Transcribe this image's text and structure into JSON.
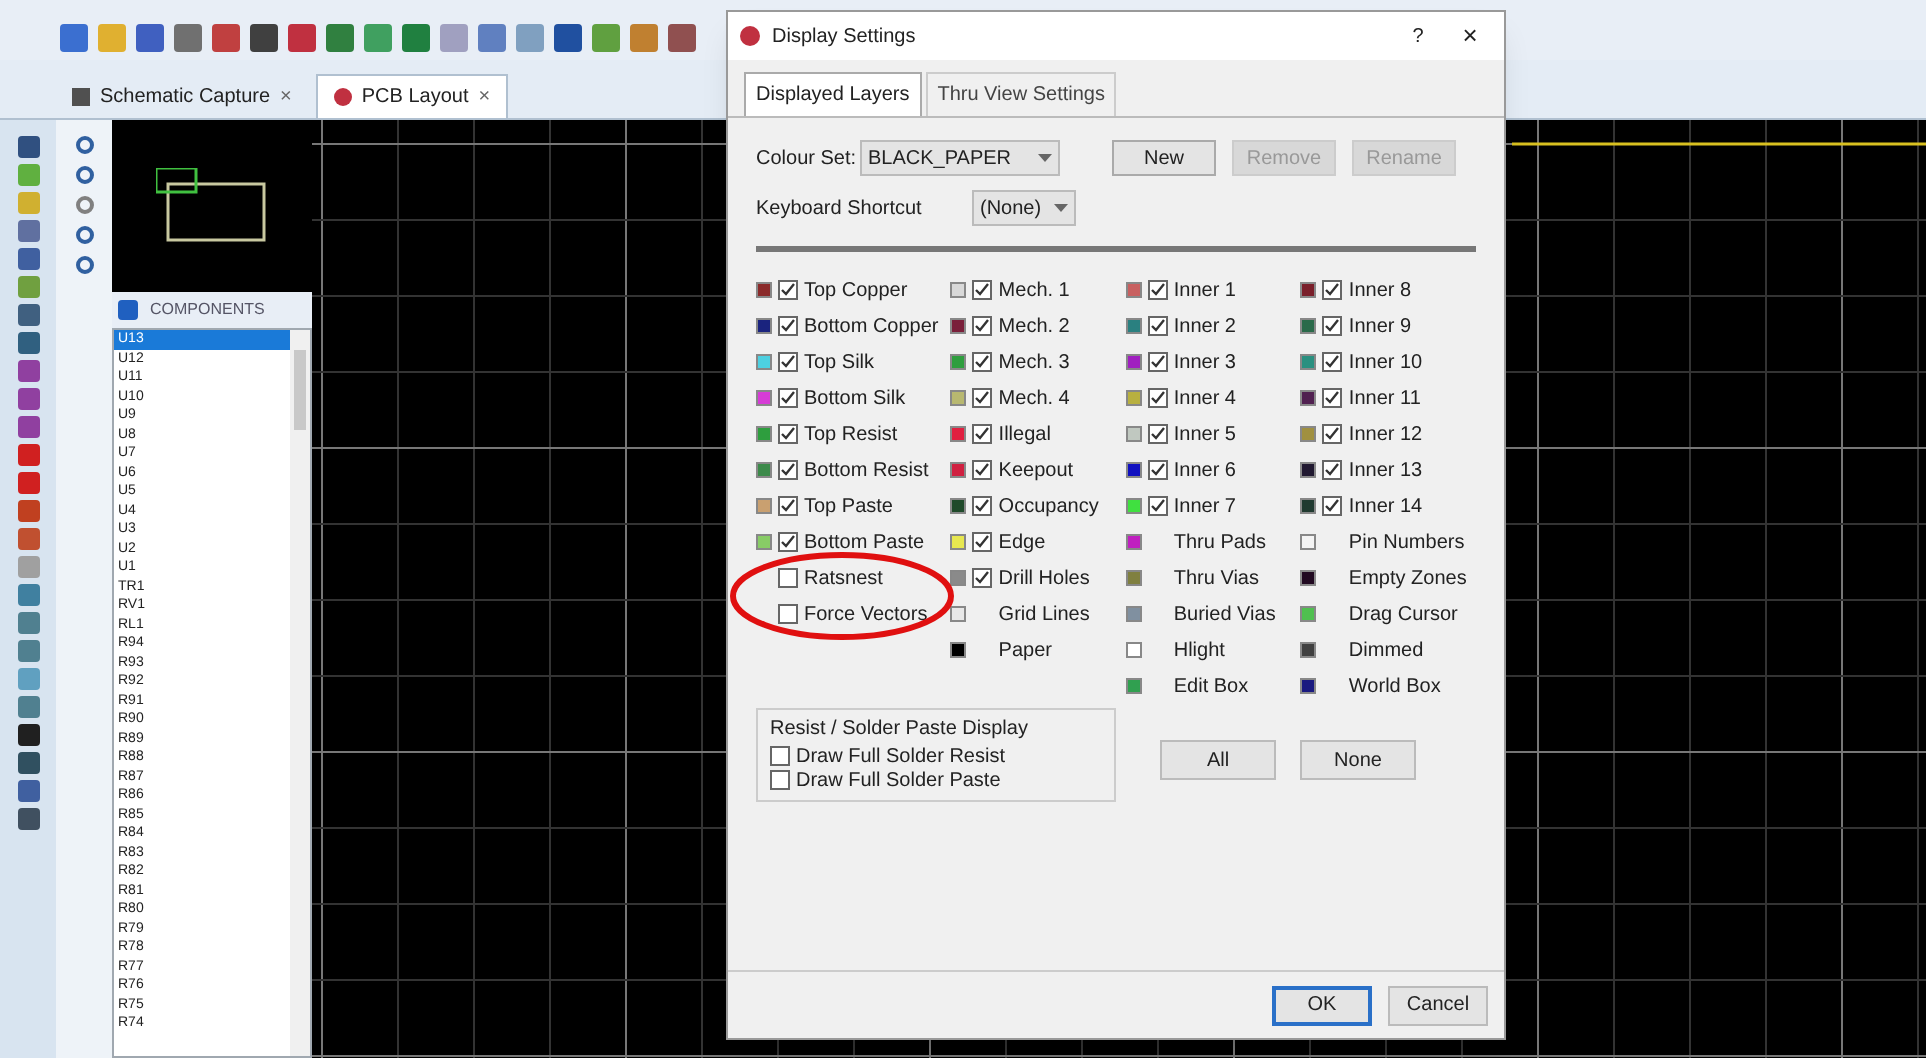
{
  "app_tabs": [
    {
      "label": "Schematic Capture",
      "close": "×",
      "selected": false
    },
    {
      "label": "PCB Layout",
      "close": "×",
      "selected": true
    }
  ],
  "components": {
    "header": "COMPONENTS",
    "items": [
      {
        "label": "U13",
        "selected": true
      },
      {
        "label": "U12",
        "selected": false
      },
      {
        "label": "U11",
        "selected": false
      },
      {
        "label": "U10",
        "selected": false
      },
      {
        "label": "U9",
        "selected": false
      },
      {
        "label": "U8",
        "selected": false
      },
      {
        "label": "U7",
        "selected": false
      },
      {
        "label": "U6",
        "selected": false
      },
      {
        "label": "U5",
        "selected": false
      },
      {
        "label": "U4",
        "selected": false
      },
      {
        "label": "U3",
        "selected": false
      },
      {
        "label": "U2",
        "selected": false
      },
      {
        "label": "U1",
        "selected": false
      },
      {
        "label": "TR1",
        "selected": false
      },
      {
        "label": "RV1",
        "selected": false
      },
      {
        "label": "RL1",
        "selected": false
      },
      {
        "label": "R94",
        "selected": false
      },
      {
        "label": "R93",
        "selected": false
      },
      {
        "label": "R92",
        "selected": false
      },
      {
        "label": "R91",
        "selected": false
      },
      {
        "label": "R90",
        "selected": false
      },
      {
        "label": "R89",
        "selected": false
      },
      {
        "label": "R88",
        "selected": false
      },
      {
        "label": "R87",
        "selected": false
      },
      {
        "label": "R86",
        "selected": false
      },
      {
        "label": "R85",
        "selected": false
      },
      {
        "label": "R84",
        "selected": false
      },
      {
        "label": "R83",
        "selected": false
      },
      {
        "label": "R82",
        "selected": false
      },
      {
        "label": "R81",
        "selected": false
      },
      {
        "label": "R80",
        "selected": false
      },
      {
        "label": "R79",
        "selected": false
      },
      {
        "label": "R78",
        "selected": false
      },
      {
        "label": "R77",
        "selected": false
      },
      {
        "label": "R76",
        "selected": false
      },
      {
        "label": "R75",
        "selected": false
      },
      {
        "label": "R74",
        "selected": false
      }
    ]
  },
  "dialog": {
    "title": "Display Settings",
    "help": "?",
    "close": "×",
    "tabs": [
      {
        "label": "Displayed Layers",
        "selected": true
      },
      {
        "label": "Thru View Settings",
        "selected": false
      }
    ],
    "colour_set": {
      "label": "Colour Set:",
      "value": "BLACK_PAPER"
    },
    "colour_buttons": [
      {
        "label": "New",
        "disabled": false
      },
      {
        "label": "Remove",
        "disabled": true
      },
      {
        "label": "Rename",
        "disabled": true
      }
    ],
    "keyboard_shortcut": {
      "label": "Keyboard Shortcut",
      "value": "(None)"
    },
    "layer_columns": [
      [
        {
          "label": "Top Copper",
          "kind": "check",
          "checked": true,
          "color": "#8b2a2a"
        },
        {
          "label": "Bottom Copper",
          "kind": "check",
          "checked": true,
          "color": "#1a237e"
        },
        {
          "label": "Top Silk",
          "kind": "check",
          "checked": true,
          "color": "#4dd0e1"
        },
        {
          "label": "Bottom Silk",
          "kind": "check",
          "checked": true,
          "color": "#d63cd6"
        },
        {
          "label": "Top Resist",
          "kind": "check",
          "checked": true,
          "color": "#2e9e3e"
        },
        {
          "label": "Bottom Resist",
          "kind": "check",
          "checked": true,
          "color": "#3c8a4a"
        },
        {
          "label": "Top Paste",
          "kind": "check",
          "checked": true,
          "color": "#c9a070"
        },
        {
          "label": "Bottom Paste",
          "kind": "check",
          "checked": true,
          "color": "#88cc66"
        },
        {
          "label": "Ratsnest",
          "kind": "checkonly",
          "checked": false
        },
        {
          "label": "Force Vectors",
          "kind": "checkonly",
          "checked": false
        }
      ],
      [
        {
          "label": "Mech. 1",
          "kind": "check",
          "checked": true,
          "color": "#d8d8d8"
        },
        {
          "label": "Mech. 2",
          "kind": "check",
          "checked": true,
          "color": "#7a1f3a"
        },
        {
          "label": "Mech. 3",
          "kind": "check",
          "checked": true,
          "color": "#2e9e3e"
        },
        {
          "label": "Mech. 4",
          "kind": "check",
          "checked": true,
          "color": "#b8b870"
        },
        {
          "label": "Illegal",
          "kind": "check",
          "checked": true,
          "color": "#e02040"
        },
        {
          "label": "Keepout",
          "kind": "check",
          "checked": true,
          "color": "#d02040"
        },
        {
          "label": "Occupancy",
          "kind": "check",
          "checked": true,
          "color": "#1f4a2a"
        },
        {
          "label": "Edge",
          "kind": "check",
          "checked": true,
          "color": "#e8e850"
        },
        {
          "label": "Drill Holes",
          "kind": "check",
          "checked": true,
          "color": "#8a8a8a"
        },
        {
          "label": "Grid Lines",
          "kind": "plain",
          "color": "#e8e8e8"
        },
        {
          "label": "Paper",
          "kind": "plain",
          "color": "#000000"
        }
      ],
      [
        {
          "label": "Inner 1",
          "kind": "check",
          "checked": true,
          "color": "#c86060"
        },
        {
          "label": "Inner 2",
          "kind": "check",
          "checked": true,
          "color": "#2a8080"
        },
        {
          "label": "Inner 3",
          "kind": "check",
          "checked": true,
          "color": "#a020c0"
        },
        {
          "label": "Inner 4",
          "kind": "check",
          "checked": true,
          "color": "#b8b040"
        },
        {
          "label": "Inner 5",
          "kind": "check",
          "checked": true,
          "color": "#c0c8c0"
        },
        {
          "label": "Inner 6",
          "kind": "check",
          "checked": true,
          "color": "#1010c0"
        },
        {
          "label": "Inner 7",
          "kind": "check",
          "checked": true,
          "color": "#40e040"
        },
        {
          "label": "Thru Pads",
          "kind": "plain",
          "color": "#c020c0"
        },
        {
          "label": "Thru Vias",
          "kind": "plain",
          "color": "#808040"
        },
        {
          "label": "Buried Vias",
          "kind": "plain",
          "color": "#8090a0"
        },
        {
          "label": "Hlight",
          "kind": "plain",
          "color": "#ffffff"
        },
        {
          "label": "Edit Box",
          "kind": "plain",
          "color": "#30a050"
        }
      ],
      [
        {
          "label": "Inner 8",
          "kind": "check",
          "checked": true,
          "color": "#7a1f2a"
        },
        {
          "label": "Inner 9",
          "kind": "check",
          "checked": true,
          "color": "#2a6a4a"
        },
        {
          "label": "Inner 10",
          "kind": "check",
          "checked": true,
          "color": "#2a9080"
        },
        {
          "label": "Inner 11",
          "kind": "check",
          "checked": true,
          "color": "#502050"
        },
        {
          "label": "Inner 12",
          "kind": "check",
          "checked": true,
          "color": "#a09040"
        },
        {
          "label": "Inner 13",
          "kind": "check",
          "checked": true,
          "color": "#201830"
        },
        {
          "label": "Inner 14",
          "kind": "check",
          "checked": true,
          "color": "#203a30"
        },
        {
          "label": "Pin Numbers",
          "kind": "plain",
          "color": "#f4f4f4"
        },
        {
          "label": "Empty Zones",
          "kind": "plain",
          "color": "#200820"
        },
        {
          "label": "Drag Cursor",
          "kind": "plain",
          "color": "#50c050"
        },
        {
          "label": "Dimmed",
          "kind": "plain",
          "color": "#404040"
        },
        {
          "label": "World Box",
          "kind": "plain",
          "color": "#1a1a80"
        }
      ]
    ],
    "solder_group": {
      "title": "Resist / Solder Paste Display",
      "options": [
        {
          "label": "Draw Full Solder Resist",
          "checked": false
        },
        {
          "label": "Draw Full Solder Paste",
          "checked": false
        }
      ]
    },
    "select_buttons": [
      "All",
      "None"
    ],
    "footer_buttons": [
      "OK",
      "Cancel"
    ]
  }
}
